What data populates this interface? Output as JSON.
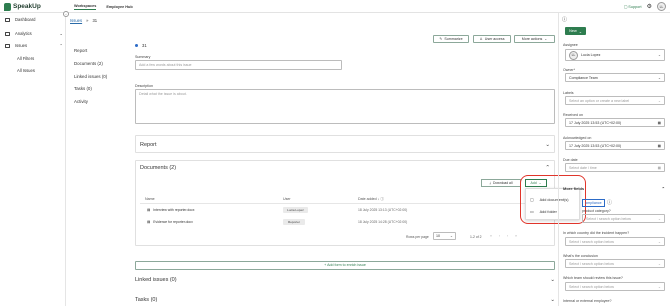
{
  "app": {
    "logo_text": "SpeakUp"
  },
  "topnav": {
    "workspaces": "Workspaces",
    "employee_hub": "Employee Hub"
  },
  "topright": {
    "support": "Support",
    "avatar_initials": "LL"
  },
  "sidebar": {
    "dashboard": "Dashboard",
    "analytics": "Analytics",
    "issues": "Issues",
    "all_filters": "All Filters",
    "all_issues": "All Issues"
  },
  "breadcrumb": {
    "issues": "Issues",
    "sep": "»",
    "id": "31"
  },
  "secnav": {
    "report": "Report",
    "documents": "Documents (2)",
    "linked": "Linked issues (0)",
    "tasks": "Tasks (0)",
    "activity": "Activity"
  },
  "issue": {
    "id": "31"
  },
  "actions": {
    "summarize": "Summarize",
    "user_access": "User access",
    "more_actions": "More actions"
  },
  "form": {
    "summary_label": "Summary",
    "summary_placeholder": "Add a few words about this issue",
    "description_label": "Description",
    "description_placeholder": "Detail what the issue is about."
  },
  "sections": {
    "report": "Report",
    "documents": "Documents (2)",
    "linked": "Linked issues (0)",
    "tasks": "Tasks (0)"
  },
  "documents": {
    "download_all": "Download all",
    "add": "Add",
    "columns": {
      "name": "Name",
      "user": "User",
      "date": "Date added"
    },
    "rows": [
      {
        "name": "Interview with reporter.docx",
        "user": "Lucia Lopez",
        "date": "18 July 2025 13:13 (UTC+02:00)"
      },
      {
        "name": "Evidence for reporter.docx",
        "user": "Reporter",
        "date": "18 July 2025 14:28 (UTC+02:00)"
      }
    ],
    "rows_per_page_label": "Rows per page",
    "rows_per_page": "10",
    "range": "1-2 of 2"
  },
  "add_menu": {
    "add_documents": "Add document(s)",
    "add_folder": "Add folder"
  },
  "add_form_button": "+ Add form to enrich issue",
  "right_panel": {
    "new_button": "New",
    "assignee_label": "Assignee",
    "assignee_value": "Lucia Lopez",
    "assignee_initials": "LL",
    "owner_label": "Owner*",
    "owner_value": "Compliance Team",
    "labels_label": "Labels",
    "labels_placeholder": "Select an option or create a new label",
    "received_label": "Received on",
    "received_value": "17 July 2025 13:53 (UTC+02:00)",
    "ack_label": "Acknowledged on",
    "ack_value": "17 July 2025 13:53 (UTC+02:00)",
    "due_label": "Due date",
    "due_placeholder": "Select date / time",
    "more_fields": "More fields",
    "compliance_chip": "ompliance",
    "product_category_label": "product category?",
    "country_label": "In which country did the incident happen?",
    "conclusion_label": "What's the conclusion",
    "team_label": "Which team should review this issue?",
    "internal_label": "Internal or external employee?",
    "select_placeholder": "Select / search option below"
  }
}
